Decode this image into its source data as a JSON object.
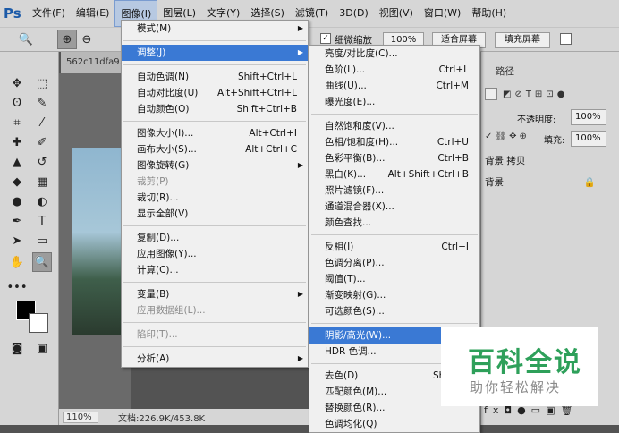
{
  "app": {
    "logo": "Ps"
  },
  "menubar": {
    "items": [
      "文件(F)",
      "编辑(E)",
      "图像(I)",
      "图层(L)",
      "文字(Y)",
      "选择(S)",
      "滤镜(T)",
      "3D(D)",
      "视图(V)",
      "窗口(W)",
      "帮助(H)"
    ]
  },
  "options": {
    "zoom_all": "细微缩放",
    "percent": "100%",
    "fit_screen": "适合屏幕",
    "fill_screen": "填充屏幕"
  },
  "document": {
    "tab": "562c11dfa9..."
  },
  "status": {
    "zoom": "110%",
    "doc_info": "文档:226.9K/453.8K"
  },
  "image_menu": {
    "items": [
      {
        "label": "模式(M)",
        "shortcut": "",
        "submenu": true,
        "disabled": false
      },
      {
        "sep": true
      },
      {
        "label": "调整(J)",
        "shortcut": "",
        "submenu": true,
        "disabled": false,
        "highlight": true
      },
      {
        "sep": true
      },
      {
        "label": "自动色调(N)",
        "shortcut": "Shift+Ctrl+L"
      },
      {
        "label": "自动对比度(U)",
        "shortcut": "Alt+Shift+Ctrl+L"
      },
      {
        "label": "自动颜色(O)",
        "shortcut": "Shift+Ctrl+B"
      },
      {
        "sep": true
      },
      {
        "label": "图像大小(I)...",
        "shortcut": "Alt+Ctrl+I"
      },
      {
        "label": "画布大小(S)...",
        "shortcut": "Alt+Ctrl+C"
      },
      {
        "label": "图像旋转(G)",
        "shortcut": "",
        "submenu": true
      },
      {
        "label": "裁剪(P)",
        "shortcut": "",
        "disabled": true
      },
      {
        "label": "裁切(R)...",
        "shortcut": ""
      },
      {
        "label": "显示全部(V)",
        "shortcut": ""
      },
      {
        "sep": true
      },
      {
        "label": "复制(D)...",
        "shortcut": ""
      },
      {
        "label": "应用图像(Y)...",
        "shortcut": ""
      },
      {
        "label": "计算(C)...",
        "shortcut": ""
      },
      {
        "sep": true
      },
      {
        "label": "变量(B)",
        "shortcut": "",
        "submenu": true
      },
      {
        "label": "应用数据组(L)...",
        "shortcut": "",
        "disabled": true
      },
      {
        "sep": true
      },
      {
        "label": "陷印(T)...",
        "shortcut": "",
        "disabled": true
      },
      {
        "sep": true
      },
      {
        "label": "分析(A)",
        "shortcut": "",
        "submenu": true
      }
    ]
  },
  "adjust_menu": {
    "items": [
      {
        "label": "亮度/对比度(C)...",
        "shortcut": ""
      },
      {
        "label": "色阶(L)...",
        "shortcut": "Ctrl+L"
      },
      {
        "label": "曲线(U)...",
        "shortcut": "Ctrl+M"
      },
      {
        "label": "曝光度(E)...",
        "shortcut": ""
      },
      {
        "sep": true
      },
      {
        "label": "自然饱和度(V)...",
        "shortcut": ""
      },
      {
        "label": "色相/饱和度(H)...",
        "shortcut": "Ctrl+U"
      },
      {
        "label": "色彩平衡(B)...",
        "shortcut": "Ctrl+B"
      },
      {
        "label": "黑白(K)...",
        "shortcut": "Alt+Shift+Ctrl+B"
      },
      {
        "label": "照片滤镜(F)...",
        "shortcut": ""
      },
      {
        "label": "通道混合器(X)...",
        "shortcut": ""
      },
      {
        "label": "颜色查找...",
        "shortcut": ""
      },
      {
        "sep": true
      },
      {
        "label": "反相(I)",
        "shortcut": "Ctrl+I"
      },
      {
        "label": "色调分离(P)...",
        "shortcut": ""
      },
      {
        "label": "阈值(T)...",
        "shortcut": ""
      },
      {
        "label": "渐变映射(G)...",
        "shortcut": ""
      },
      {
        "label": "可选颜色(S)...",
        "shortcut": ""
      },
      {
        "sep": true
      },
      {
        "label": "阴影/高光(W)...",
        "shortcut": "",
        "highlight": true
      },
      {
        "label": "HDR 色调...",
        "shortcut": ""
      },
      {
        "sep": true
      },
      {
        "label": "去色(D)",
        "shortcut": "Shift+C"
      },
      {
        "label": "匹配颜色(M)...",
        "shortcut": ""
      },
      {
        "label": "替换颜色(R)...",
        "shortcut": ""
      },
      {
        "label": "色调均化(Q)",
        "shortcut": ""
      }
    ]
  },
  "layers_panel": {
    "tab": "路径",
    "opacity_label": "不透明度:",
    "opacity_value": "100%",
    "fill_label": "填充:",
    "fill_value": "100%",
    "layers": [
      "背景 拷贝",
      "背景"
    ]
  },
  "watermark": {
    "title": "百科全说",
    "subtitle": "助你轻松解决"
  },
  "colors": {
    "accent": "#3a79d4",
    "brand": "#2ea05a"
  }
}
